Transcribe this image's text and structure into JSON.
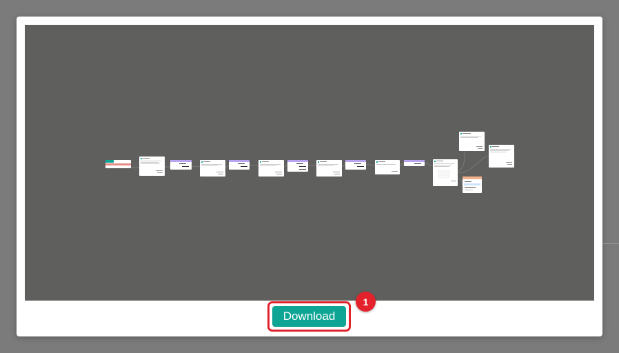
{
  "modal": {
    "download_label": "Download"
  },
  "annotation": {
    "step": "1"
  },
  "colors": {
    "accent": "#0ea594",
    "highlight": "#e0232c",
    "preview_bg": "#5f605e",
    "node_header_purple": "#b9a4f1",
    "node_header_red": "#e88a85",
    "node_header_orange": "#f3b08a"
  }
}
